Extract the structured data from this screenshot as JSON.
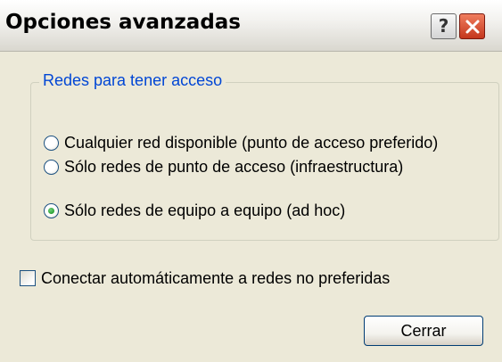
{
  "window": {
    "title": "Opciones avanzadas"
  },
  "titlebar": {
    "help_label": "?",
    "close_icon": "close-x-icon"
  },
  "group": {
    "legend": "Redes para tener acceso",
    "options": [
      {
        "label": "Cualquier red disponible (punto de acceso preferido)",
        "checked": false
      },
      {
        "label": "Sólo redes de punto de acceso (infraestructura)",
        "checked": false
      },
      {
        "label": "Sólo redes de equipo a equipo (ad hoc)",
        "checked": true
      }
    ]
  },
  "auto_connect": {
    "label": "Conectar automáticamente a redes no preferidas",
    "checked": false
  },
  "buttons": {
    "close_label": "Cerrar"
  },
  "colors": {
    "legend_blue": "#0046d5",
    "close_red": "#c4371d",
    "radio_green": "#2a9f33"
  }
}
